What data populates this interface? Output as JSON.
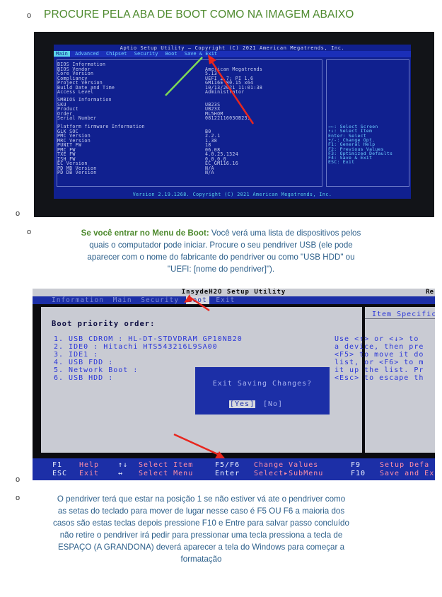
{
  "bullets": {
    "symbol": "o"
  },
  "heading": "PROCURE PELA ABA DE BOOT COMO NA IMAGEM ABAIXO",
  "bios1": {
    "title": "Aptio Setup Utility – Copyright (C) 2021 American Megatrends, Inc.",
    "tabs": [
      "Main",
      "Advanced",
      "Chipset",
      "Security",
      "Boot",
      "Save & Exit"
    ],
    "active_tab": "Main",
    "rows": [
      {
        "label": "BIOS Information",
        "value": ""
      },
      {
        "label": "BIOS Vendor",
        "value": "American Megatrends"
      },
      {
        "label": "Core Version",
        "value": "5.13"
      },
      {
        "label": "Compliancy",
        "value": "UEFI 2.7; PI 1.6"
      },
      {
        "label": "Project Version",
        "value": "GM116E 80.15 x64"
      },
      {
        "label": "Build Date and Time",
        "value": "10/13/2021 11:01:38"
      },
      {
        "label": "Access Level",
        "value": "Administrator"
      },
      {
        "label": "SMBIOS Information",
        "value": ""
      },
      {
        "label": "SKU",
        "value": "UB23S"
      },
      {
        "label": "Product",
        "value": "UB23X"
      },
      {
        "label": "Order",
        "value": "ML5HOM"
      },
      {
        "label": "Serial Number",
        "value": "0812211603OB231"
      },
      {
        "label": "Platform firmware Information",
        "value": ""
      },
      {
        "label": "GLK SOC",
        "value": "B0"
      },
      {
        "label": "PMC Version",
        "value": "2.2.1"
      },
      {
        "label": "MRC Version",
        "value": "1.38"
      },
      {
        "label": "PUNIT FW",
        "value": "18"
      },
      {
        "label": "PMC FW",
        "value": "06.08"
      },
      {
        "label": "TXE FW",
        "value": "4.0.25.1324"
      },
      {
        "label": "ISH FW",
        "value": "0.0.0.0"
      },
      {
        "label": "EC Version",
        "value": "EC_GM116.16"
      },
      {
        "label": "PD MB Version",
        "value": "N/A"
      },
      {
        "label": "PD DB Version",
        "value": "N/A"
      }
    ],
    "help": [
      "→←: Select Screen",
      "↑↓: Select Item",
      "Enter: Select",
      "+/-: Change Opt.",
      "F1: General Help",
      "F2: Previous Values",
      "F3: Optimized Defaults",
      "F4: Save & Exit",
      "ESC: Exit"
    ],
    "footer": "Version 2.19.1268. Copyright (C) 2021 American Megatrends, Inc."
  },
  "para1": {
    "bold": "Se você entrar no Menu de Boot:",
    "lines": [
      " Você verá uma lista de dispositivos pelos",
      "quais o computador pode iniciar. Procure o seu pendriver USB (ele pode",
      "aparecer com o nome do fabricante do pendriver ou como \"USB HDD\" ou",
      "\"UEFI: [nome do pendriver]\")."
    ]
  },
  "bios2": {
    "title": "InsydeH2O Setup Utility",
    "title_right": "Re",
    "tabs": [
      "Information",
      "Main",
      "Security",
      "Boot",
      "Exit"
    ],
    "active_tab": "Boot",
    "priority_label": "Boot priority order:",
    "items": [
      "1. USB CDROM : HL-DT-STDVDRAM GP10NB20",
      "2. IDE0 : Hitachi HTS543216L9SA00",
      "3. IDE1 :",
      "4. USB FDD :",
      "5. Network Boot :",
      "6. USB HDD :"
    ],
    "side_title": "Item Specific He",
    "side_help": [
      "Use <↑> or <↓> to",
      "a device, then pre",
      "<F5> to move it do",
      "list, or <F6> to m",
      "it up the list. Pr",
      "<Esc> to escape th"
    ],
    "dialog_title": "Exit Saving Changes?",
    "dialog_yes": "[Yes]",
    "dialog_no": "[No]",
    "bottom_row1": [
      {
        "key": "F1",
        "desc": "Help"
      },
      {
        "key": "↑↓",
        "desc": "Select Item"
      },
      {
        "key": "F5/F6",
        "desc": "Change Values"
      },
      {
        "key": "F9",
        "desc": "Setup Defa"
      }
    ],
    "bottom_row2": [
      {
        "key": "ESC",
        "desc": "Exit"
      },
      {
        "key": "↔",
        "desc": "Select Menu"
      },
      {
        "key": "Enter",
        "desc": "Select▸SubMenu"
      },
      {
        "key": "F10",
        "desc": "Save and Ex"
      }
    ]
  },
  "para2": {
    "lines": [
      "O pendriver terá que estar na posição 1 se não estiver vá ate o pendriver como",
      "as setas do teclado para mover de lugar nesse caso é F5 OU F6 a maioria dos",
      "casos são estas teclas depois pressione F10 e Entre para salvar passo concluído",
      "não retire o pendriver irá pedir para pressionar uma tecla pressiona a tecla de",
      "ESPAÇO (A GRANDONA) deverá aparecer a tela do Windows para começar a",
      "formatação"
    ]
  },
  "colors": {
    "heading": "#4e8a2e",
    "body_text": "#2c5f8a",
    "arrow_red": "#e8261e",
    "arrow_green": "#7ed957"
  }
}
